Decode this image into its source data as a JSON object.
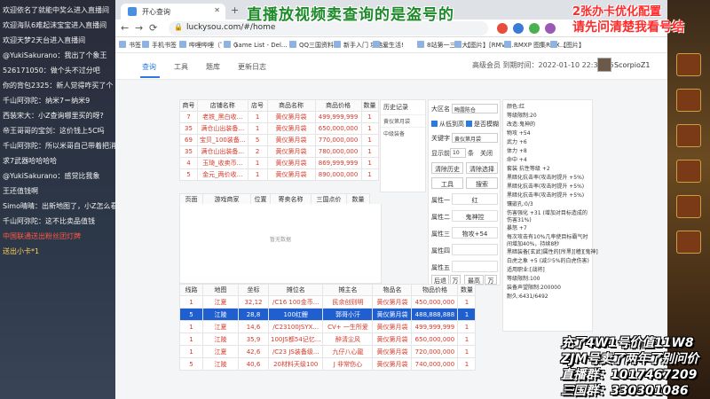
{
  "overlay": {
    "top_title": "直播放视频卖查询的是盗号的",
    "top_right_1": "2张办卡优化配置",
    "top_right_2": "请先问清楚我看号结",
    "bottom_right": [
      "充了4W1号价值11W8",
      "ZJM号卖了两年了别问价",
      "直播群：1017467209",
      "三国群：330301086"
    ]
  },
  "chat": [
    {
      "text": "欢迎依名了就能中奖么进入直播间",
      "style": "w"
    },
    {
      "text": "欢迎海队6难起沫宝宝进入直播间",
      "style": "w"
    },
    {
      "text": "欢迎天梦2天台进入直播间",
      "style": "w"
    },
    {
      "text": "@YukiSakurano：我出了个象王",
      "style": "w"
    },
    {
      "text": "526171050：做个头不过分吧",
      "style": "w"
    },
    {
      "text": "你的背包2325：新人觉得咋买了个",
      "style": "w"
    },
    {
      "text": "千山阿弥陀：纳米7＝纳米9",
      "style": "w"
    },
    {
      "text": "西装宋大：小Z查询哪里买的呀?",
      "style": "w"
    },
    {
      "text": "帝王哥哥的宝剑：这价钱上5C吗",
      "style": "w"
    },
    {
      "text": "千山阿弥陀：所以米哥自己带着把消",
      "style": "w"
    },
    {
      "text": "求7武器哈哈哈哈",
      "style": "w"
    },
    {
      "text": "@YukiSakurano：感觉比我象",
      "style": "w"
    },
    {
      "text": "王还值钱啊",
      "style": "w"
    },
    {
      "text": "Simo晴晴：出新地图了，小Z怎么看?",
      "style": "w"
    },
    {
      "text": "千山阿弥陀：这不比卖品值钱",
      "style": "w"
    },
    {
      "text": "中国联通送出粉丝团灯牌",
      "style": "r"
    },
    {
      "text": "送出小卡*1",
      "style": "g"
    }
  ],
  "browser": {
    "tab_title": "开心查询",
    "url": "luckysou.com/#/home",
    "bookmarks": [
      "书签",
      "手机书签",
      "哔哩哔哩（゜-゜）",
      "Game List - Del...",
      "QQ三国资料站",
      "新手入门 攻略...",
      "爱生活!",
      "8站第一三国大...",
      "【图片】[RMVA]...",
      "RMXP 图集RMX...",
      "【图片】"
    ]
  },
  "appnav": {
    "tabs": [
      "查询",
      "工具",
      "题库",
      "更新日志"
    ],
    "vip": "高级会员 到期时间：2022-01-10 22:39:56",
    "user": "ScorpioZ1"
  },
  "shop_table": {
    "headers": [
      "商号",
      "店铺名称",
      "店号",
      "商品名称",
      "商品价格",
      "数量"
    ],
    "rows": [
      [
        "7",
        "老铁_黑白收...",
        "1",
        "黄仪第月袋",
        "499,999,999",
        "1"
      ],
      [
        "35",
        "满仓山出装备...",
        "1",
        "黄仪第月袋",
        "650,000,000",
        "1"
      ],
      [
        "69",
        "宝贝_100装备...",
        "5",
        "黄仪第月袋",
        "770,000,000",
        "1"
      ],
      [
        "35",
        "满仓山出装备...",
        "2",
        "黄仪第月袋",
        "780,000,000",
        "1"
      ],
      [
        "4",
        "玉琦_收卖币...",
        "1",
        "黄仪第月袋",
        "869,999,999",
        "1"
      ],
      [
        "5",
        "金元_两价收...",
        "1",
        "黄仪第月袋",
        "890,000,000",
        "1"
      ]
    ]
  },
  "history": {
    "header": "历史记录",
    "items": [
      "黄仪第月袋",
      "中级装备"
    ]
  },
  "controls": {
    "region_label": "大区名",
    "region_value": "晦露陈仓",
    "check1": "从低到高",
    "check2": "是否模糊",
    "keyword_label": "关键字",
    "keyword_value": "黄仪第月袋",
    "show_label": "显示前",
    "show_value": "10",
    "show_unit": "条",
    "close": "关闭",
    "btn_clear": "清除历史",
    "btn_clear2": "清除选择",
    "btn_tool": "工具",
    "btn_search": "搜索",
    "attr_labels": [
      "属性一",
      "属性二",
      "属性三",
      "属性四",
      "属性五"
    ],
    "attr_values": [
      "红",
      "鬼神控",
      "物攻+54",
      "",
      ""
    ],
    "btn_back": "后退",
    "btn_wan": "万",
    "btn_sort": "最高",
    "btn_wan2": "万"
  },
  "attrs_panel": [
    "颜色:红",
    "等级限制:20",
    "改造:鬼神的",
    "物攻 +54",
    "武力 +6",
    "体力 +8",
    "命中 +4",
    "套装 抗性等级 +2",
    "黑暗化抗击率(攻击时提升 +5%)",
    "黑暗化抗击率(攻击时提升 +5%)",
    "黑暗化抗击率(攻击时提升 +5%)",
    "镶嵌孔:0/3",
    "伤害强化 +31 (增加对目标造成的伤害31%)",
    "暴怒 +7",
    "每次攻击有10%几率使目标霸气时间增加40%，持续8秒",
    "黑暗装备[玄武]属性的[所黑][稽][鬼神]",
    "白虎之象 +5 (减少5%的白虎伤害)",
    "适用职业:[战将]",
    "等级限制:100",
    "装备声望限制:200000",
    "耐久:6431/6492"
  ],
  "lower_table": {
    "headers": [
      "页面",
      "游戏商家",
      "位置",
      "寄卖名称",
      "三国点价",
      "数量"
    ],
    "empty": "暂无数据"
  },
  "stall_table": {
    "headers": [
      "线路",
      "地图",
      "坐标",
      "摊位名",
      "摊主名",
      "物品名",
      "物品价格",
      "数量"
    ],
    "rows": [
      [
        "1",
        "江夏",
        "32,12",
        "/C16 100金币...",
        "民余创则明",
        "黄仪第月袋",
        "450,000,000",
        "1"
      ],
      [
        "5",
        "江陵",
        "28,8",
        "100红鲤",
        "郭哥小汗",
        "黄仪第月袋",
        "488,888,888",
        "1"
      ],
      [
        "1",
        "江夏",
        "14,6",
        "/C23100JSYX...",
        "CV+ 一生所爱",
        "黄仪第月袋",
        "499,999,999",
        "1"
      ],
      [
        "1",
        "江陵",
        "35,9",
        "100JS都54记忆...",
        "醉清尘风",
        "黄仪第月袋",
        "650,000,000",
        "1"
      ],
      [
        "1",
        "江夏",
        "42,6",
        "/C23 JS装备级...",
        "九仔八心龍",
        "黄仪第月袋",
        "720,000,000",
        "1"
      ],
      [
        "5",
        "江陵",
        "40,6",
        "20材料天级100",
        "J 非常伤心",
        "黄仪第月袋",
        "740,000,000",
        "1"
      ]
    ]
  }
}
